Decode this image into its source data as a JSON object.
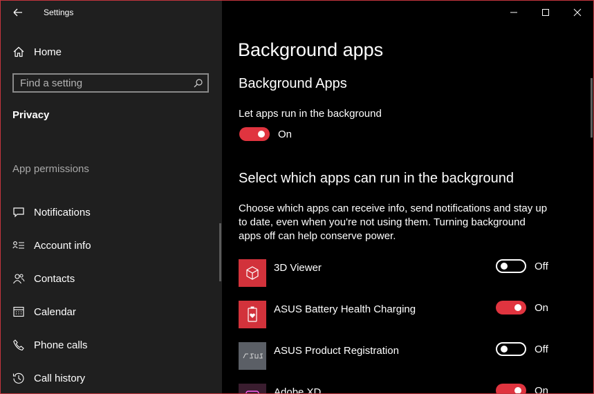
{
  "window": {
    "title": "Settings"
  },
  "sidebar": {
    "home_label": "Home",
    "search_placeholder": "Find a setting",
    "section_heading": "Privacy",
    "group_label": "App permissions",
    "items": [
      {
        "label": "Notifications",
        "icon": "notifications-icon"
      },
      {
        "label": "Account info",
        "icon": "account-info-icon"
      },
      {
        "label": "Contacts",
        "icon": "contacts-icon"
      },
      {
        "label": "Calendar",
        "icon": "calendar-icon"
      },
      {
        "label": "Phone calls",
        "icon": "phone-icon"
      },
      {
        "label": "Call history",
        "icon": "history-icon"
      }
    ]
  },
  "main": {
    "page_title": "Background apps",
    "section_title": "Background Apps",
    "let_apps_label": "Let apps run in the background",
    "let_apps_state": "On",
    "select_title": "Select which apps can run in the background",
    "description": "Choose which apps can receive info, send notifications and stay up to date, even when you're not using them. Turning background apps off can help conserve power.",
    "apps": [
      {
        "name": "3D Viewer",
        "state": "Off",
        "on": false
      },
      {
        "name": "ASUS Battery Health Charging",
        "state": "On",
        "on": true
      },
      {
        "name": "ASUS Product Registration",
        "state": "Off",
        "on": false
      },
      {
        "name": "Adobe XD",
        "state": "On",
        "on": true
      }
    ]
  },
  "colors": {
    "accent": "#e0343f",
    "sidebar_bg": "#1f1f1f",
    "main_bg": "#000000"
  }
}
